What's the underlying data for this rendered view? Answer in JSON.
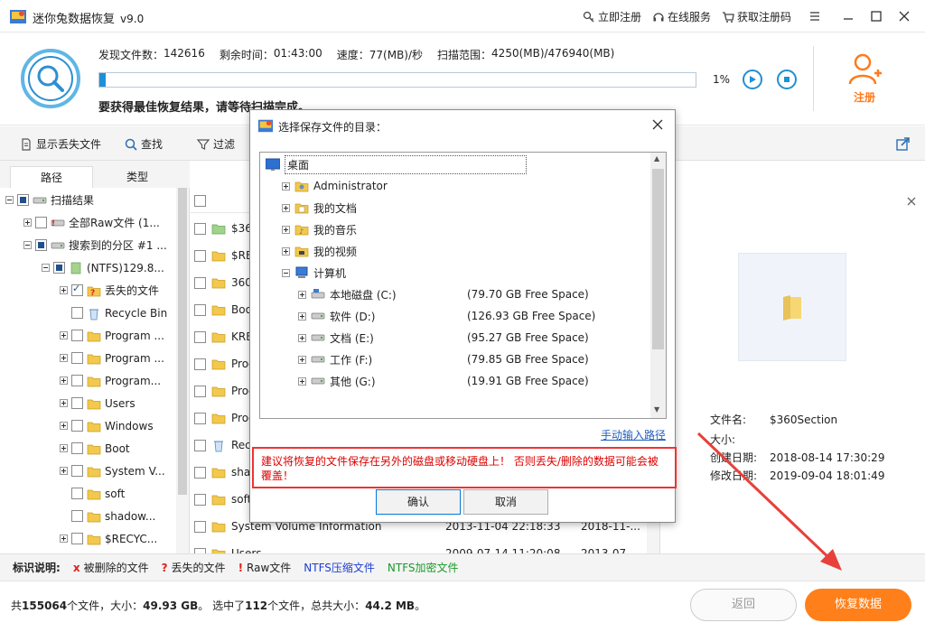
{
  "app": {
    "title": "迷你兔数据恢复",
    "version": "v9.0",
    "links": [
      "立即注册",
      "在线服务",
      "获取注册码"
    ]
  },
  "scan": {
    "stats": [
      {
        "label": "发现文件数：",
        "value": "142616"
      },
      {
        "label": "剩余时间：",
        "value": "01:43:00"
      },
      {
        "label": "速度：",
        "value": "77(MB)/秒"
      },
      {
        "label": "扫描范围：",
        "value": "4250(MB)/476940(MB)"
      }
    ],
    "progress_fraction": 0.01,
    "progress_text": "1%",
    "hint": "要获得最佳恢复结果，请等待扫描完成。",
    "register_label": "注册"
  },
  "toolbar": {
    "show_lost": "显示丢失文件",
    "find": "查找",
    "filter": "过滤"
  },
  "tabs": [
    "路径",
    "类型"
  ],
  "tree": [
    {
      "label": "扫描结果",
      "indent": 0,
      "exp": "minus",
      "cb": "partial",
      "icon": "drive-icon"
    },
    {
      "label": "全部Raw文件 (1...",
      "indent": 1,
      "exp": "plus",
      "cb": "",
      "icon": "raw-icon"
    },
    {
      "label": "搜索到的分区 #1 ...",
      "indent": 1,
      "exp": "minus",
      "cb": "partial",
      "icon": "drive-icon"
    },
    {
      "label": "(NTFS)129.8...",
      "indent": 2,
      "exp": "minus",
      "cb": "partial",
      "icon": "partition-icon"
    },
    {
      "label": "丢失的文件",
      "indent": 3,
      "exp": "plus",
      "cb": "checked",
      "icon": "lost-folder-icon"
    },
    {
      "label": "Recycle Bin",
      "indent": 3,
      "exp": "",
      "cb": "",
      "icon": "recycle-bin-icon"
    },
    {
      "label": "Program ...",
      "indent": 3,
      "exp": "plus",
      "cb": "",
      "icon": "folder-icon"
    },
    {
      "label": "Program ...",
      "indent": 3,
      "exp": "plus",
      "cb": "",
      "icon": "folder-icon"
    },
    {
      "label": "Program...",
      "indent": 3,
      "exp": "plus",
      "cb": "",
      "icon": "folder-icon"
    },
    {
      "label": "Users",
      "indent": 3,
      "exp": "plus",
      "cb": "",
      "icon": "folder-icon"
    },
    {
      "label": "Windows",
      "indent": 3,
      "exp": "plus",
      "cb": "",
      "icon": "folder-icon"
    },
    {
      "label": "Boot",
      "indent": 3,
      "exp": "plus",
      "cb": "",
      "icon": "folder-icon"
    },
    {
      "label": "System V...",
      "indent": 3,
      "exp": "plus",
      "cb": "",
      "icon": "folder-icon"
    },
    {
      "label": "soft",
      "indent": 3,
      "exp": "",
      "cb": "",
      "icon": "folder-icon"
    },
    {
      "label": "shadow...",
      "indent": 3,
      "exp": "",
      "cb": "",
      "icon": "folder-icon"
    },
    {
      "label": "$RECYC...",
      "indent": 3,
      "exp": "plus",
      "cb": "",
      "icon": "folder-icon"
    }
  ],
  "files": [
    {
      "name": "$360",
      "d1": "",
      "d2": "",
      "icon": "folder-green-icon"
    },
    {
      "name": "$RE",
      "d1": "",
      "d2": "",
      "icon": "folder-icon"
    },
    {
      "name": "360",
      "d1": "",
      "d2": "",
      "icon": "folder-icon"
    },
    {
      "name": "Boo",
      "d1": "",
      "d2": "",
      "icon": "folder-icon"
    },
    {
      "name": "KRE",
      "d1": "",
      "d2": "",
      "icon": "folder-icon"
    },
    {
      "name": "Prog",
      "d1": "",
      "d2": "",
      "icon": "folder-icon"
    },
    {
      "name": "Prog",
      "d1": "",
      "d2": "",
      "icon": "folder-icon"
    },
    {
      "name": "Prog",
      "d1": "",
      "d2": "",
      "icon": "folder-icon"
    },
    {
      "name": "Rec",
      "d1": "",
      "d2": "",
      "icon": "recycle-bin-icon"
    },
    {
      "name": "sha",
      "d1": "",
      "d2": "",
      "icon": "folder-icon"
    },
    {
      "name": "soft",
      "d1": "",
      "d2": "",
      "icon": "folder-icon"
    },
    {
      "name": "System Volume Information",
      "d1": "2013-11-04 22:18:33",
      "d2": "2018-11-...",
      "icon": "folder-icon"
    },
    {
      "name": "Users",
      "d1": "2009-07-14 11:20:08",
      "d2": "2013-07-...",
      "icon": "folder-icon"
    }
  ],
  "preview": {
    "meta": [
      {
        "k": "文件名:",
        "v": "$360Section"
      },
      {
        "k": "大小:",
        "v": ""
      },
      {
        "k": "创建日期:",
        "v": "2018-08-14 17:30:29"
      },
      {
        "k": "修改日期:",
        "v": "2019-09-04 18:01:49"
      }
    ]
  },
  "legend": {
    "title": "标识说明:",
    "items": [
      {
        "mark": "x",
        "text": "被删除的文件",
        "color": "#e02020"
      },
      {
        "mark": "?",
        "text": "丢失的文件",
        "color": "#e02020"
      },
      {
        "mark": "!",
        "text": "Raw文件",
        "color": "#e02020"
      },
      {
        "mark": "",
        "text": "NTFS压缩文件",
        "color": "#1f3fd0"
      },
      {
        "mark": "",
        "text": "NTFS加密文件",
        "color": "#1a9a2a"
      }
    ]
  },
  "status": {
    "p1": "共",
    "files": "155064",
    "p2": "个文件，大小：",
    "size": "49.93 GB",
    "p3": "。 选中了",
    "sel": "112",
    "p4": "个文件，总共大小：",
    "selsize": "44.2 MB",
    "p5": "。"
  },
  "buttons": {
    "back": "返回",
    "recover": "恢复数据"
  },
  "dialog": {
    "title": "选择保存文件的目录：",
    "tree": [
      {
        "label": "桌面",
        "indent": 0,
        "exp": "",
        "icon": "desktop-icon",
        "free": ""
      },
      {
        "label": "Administrator",
        "indent": 1,
        "exp": "plus",
        "icon": "user-folder-icon",
        "free": ""
      },
      {
        "label": "我的文档",
        "indent": 1,
        "exp": "plus",
        "icon": "documents-icon",
        "free": ""
      },
      {
        "label": "我的音乐",
        "indent": 1,
        "exp": "plus",
        "icon": "music-icon",
        "free": ""
      },
      {
        "label": "我的视频",
        "indent": 1,
        "exp": "plus",
        "icon": "video-icon",
        "free": ""
      },
      {
        "label": "计算机",
        "indent": 1,
        "exp": "minus",
        "icon": "computer-icon",
        "free": ""
      },
      {
        "label": "本地磁盘 (C:)",
        "indent": 2,
        "exp": "plus",
        "icon": "drive-c-icon",
        "free": "(79.70 GB Free Space)"
      },
      {
        "label": "软件 (D:)",
        "indent": 2,
        "exp": "plus",
        "icon": "drive-icon",
        "free": "(126.93 GB Free Space)"
      },
      {
        "label": "文档 (E:)",
        "indent": 2,
        "exp": "plus",
        "icon": "drive-icon",
        "free": "(95.27 GB Free Space)"
      },
      {
        "label": "工作 (F:)",
        "indent": 2,
        "exp": "plus",
        "icon": "drive-icon",
        "free": "(79.85 GB Free Space)"
      },
      {
        "label": "其他 (G:)",
        "indent": 2,
        "exp": "plus",
        "icon": "drive-icon",
        "free": "(19.91 GB Free Space)"
      }
    ],
    "manual": "手动输入路径",
    "warning": "建议将恢复的文件保存在另外的磁盘或移动硬盘上！ 否则丢失/删除的数据可能会被覆盖！",
    "ok": "确认",
    "cancel": "取消"
  }
}
